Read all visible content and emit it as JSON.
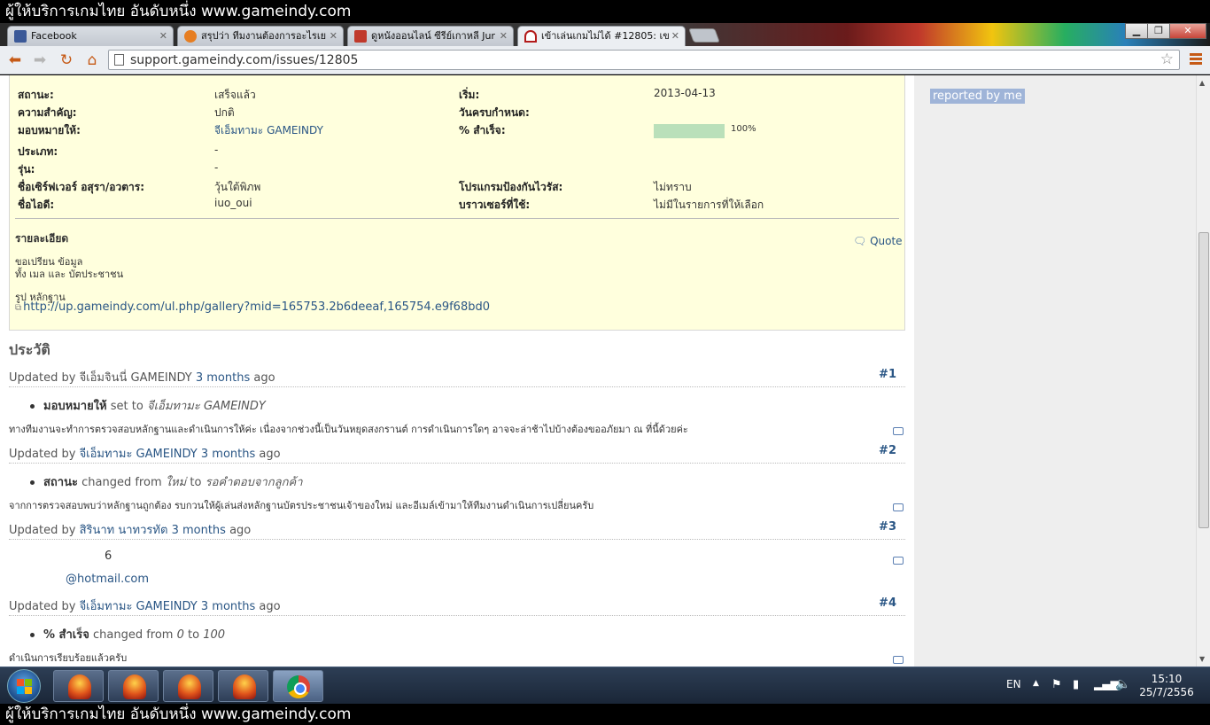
{
  "banner": {
    "text": "ผู้ให้บริการเกมไทย อันดับหนึ่ง www.gameindy.com"
  },
  "tabs": [
    {
      "title": "Facebook",
      "icon": "facebook-icon",
      "active": false
    },
    {
      "title": "สรุปว่า ทีมงานต้องการอะไรเย",
      "icon": "cat-icon",
      "active": false
    },
    {
      "title": "ดูหนังออนไลน์ ซีรีย์เกาหลี Jur",
      "icon": "crown-icon",
      "active": false
    },
    {
      "title": "เข้าเล่นเกมไม่ได้ #12805: เข",
      "icon": "redmine-icon",
      "active": true
    }
  ],
  "toolbar": {
    "url": "support.gameindy.com/issues/12805"
  },
  "sidebar": {
    "reported_by_me": "reported by me"
  },
  "issue": {
    "attrs": {
      "status_label": "สถานะ:",
      "status_value": "เสร็จแล้ว",
      "priority_label": "ความสำคัญ:",
      "priority_value": "ปกติ",
      "assignee_label": "มอบหมายให้:",
      "assignee_value": "จีเอ็มทามะ GAMEINDY",
      "category_label": "ประเภท:",
      "category_value": "-",
      "version_label": "รุ่น:",
      "version_value": "-",
      "server_label": "ชื่อเซิร์ฟเวอร์ อสุรา/อวตาร:",
      "server_value": "วุ้นใต้พิภพ",
      "id_label": "ชื่อไอดี:",
      "id_value": "iuo_oui",
      "start_label": "เริ่ม:",
      "start_value": "2013-04-13",
      "due_label": "วันครบกำหนด:",
      "due_value": "",
      "done_label": "% สำเร็จ:",
      "done_value": "100%",
      "done_fraction": 1.0,
      "antivirus_label": "โปรแกรมป้องกันไวรัส:",
      "antivirus_value": "ไม่ทราบ",
      "browser_label": "บราวเซอร์ที่ใช้:",
      "browser_value": "ไม่มีในรายการที่ให้เลือก"
    },
    "description": {
      "title": "รายละเอียด",
      "quote": "Quote",
      "line1": "ขอเปรียน ข้อมูล",
      "line2": "ทั้ง เมล และ บัตประชาชน",
      "line3": "รูป หลักฐาน",
      "link": "http://up.gameindy.com/ul.php/gallery?mid=165753.2b6deeaf,165754.e9f68bd0"
    }
  },
  "history": {
    "title": "ประวัติ",
    "updated_by": "Updated by",
    "ago_suffix": "ago",
    "journals": [
      {
        "author": "จีเอ็มจินนี่ GAMEINDY",
        "when": "3 months",
        "num": "#1",
        "detail_label": "มอบหมายให้",
        "detail_text": "set to",
        "detail_value": "จีเอ็มทามะ GAMEINDY",
        "note": "ทางทีมงานจะทำการตรวจสอบหลักฐานและดำเนินการให้ค่ะ เนื่องจากช่วงนี้เป็นวันหยุดสงกรานต์ การดำเนินการใดๆ อาจจะล่าช้าไปบ้างต้องขออภัยมา ณ ที่นี้ด้วยค่ะ"
      },
      {
        "author": "จีเอ็มทามะ GAMEINDY",
        "when": "3 months",
        "num": "#2",
        "detail_label": "สถานะ",
        "detail_text": "changed from",
        "detail_from": "ใหม่",
        "detail_to_word": "to",
        "detail_to": "รอคำตอบจากลูกค้า",
        "note": "จากการตรวจสอบพบว่าหลักฐานถูกต้อง รบกวนให้ผู้เล่นส่งหลักฐานบัตรประชาชนเจ้าของใหม่ และอีเมล์เข้ามาให้ทีมงานดำเนินการเปลี่ยนครับ"
      },
      {
        "author": "สิรินาท นาทวรทัต",
        "when": "3 months",
        "num": "#3",
        "note_num": "6",
        "note_email": "@hotmail.com"
      },
      {
        "author": "จีเอ็มทามะ GAMEINDY",
        "when": "3 months",
        "num": "#4",
        "detail_label": "% สำเร็จ",
        "detail_text": "changed from",
        "detail_from": "0",
        "detail_to_word": "to",
        "detail_to": "100",
        "note": "ดำเนินการเรียบร้อยแล้วครับ"
      }
    ]
  },
  "taskbar": {
    "lang": "EN",
    "time": "15:10",
    "date": "25/7/2556",
    "buttons": [
      "game-icon",
      "game-icon",
      "game-icon",
      "game-icon",
      "chrome-icon"
    ]
  }
}
